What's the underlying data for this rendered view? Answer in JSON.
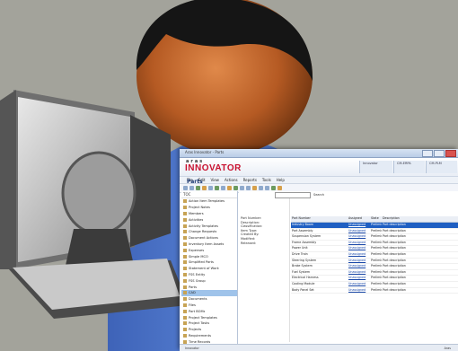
{
  "window": {
    "title": "Aras Innovator - Parts",
    "brand_small": "aras",
    "brand_name": "INNOVATOR",
    "status_1": "Innovator",
    "status_2": "CM-ERPA",
    "status_3": "CM-PLM"
  },
  "menu": [
    "File",
    "Edit",
    "View",
    "Actions",
    "Reports",
    "Tools",
    "Help"
  ],
  "sidebar": {
    "header": "TOC",
    "items": [
      "Action Item Templates",
      "Project Notes",
      "Members",
      "Activities",
      "Activity Templates",
      "Change Requests",
      "Document Actions",
      "Inventory Item Assets",
      "Expenses",
      "Simple MCO",
      "Simplified Parts",
      "Statement of Work",
      "FSS Entity",
      "FSS Group",
      "Parts",
      "CAD",
      "Documents",
      "Files",
      "Part BOMs",
      "Project Templates",
      "Project Tasks",
      "Projects",
      "Requirements",
      "Time Records",
      "Work Orders",
      "Parts"
    ],
    "selected_index": 15
  },
  "main": {
    "section": "Parts",
    "search_label": "Search",
    "detail": [
      "Part Number:",
      "Description:",
      "Classification:",
      "Item Type:",
      "Created By:",
      "Modified:",
      "Released:"
    ],
    "grid": {
      "headers": [
        "Part Number",
        "Assigned",
        "State",
        "Description"
      ],
      "rows": [
        [
          "Industry Boom",
          "Unassigned",
          "Preliminary",
          "Part description"
        ],
        [
          "Part Assembly",
          "Unassigned",
          "Preliminary",
          "Part description"
        ],
        [
          "Suspension System",
          "Unassigned",
          "Preliminary",
          "Part description"
        ],
        [
          "Frame Assembly",
          "Unassigned",
          "Preliminary",
          "Part description"
        ],
        [
          "Power Unit",
          "Unassigned",
          "Preliminary",
          "Part description"
        ],
        [
          "Drive Train",
          "Unassigned",
          "Preliminary",
          "Part description"
        ],
        [
          "Steering System",
          "Unassigned",
          "Preliminary",
          "Part description"
        ],
        [
          "Brake System",
          "Unassigned",
          "Preliminary",
          "Part description"
        ],
        [
          "Fuel System",
          "Unassigned",
          "Preliminary",
          "Part description"
        ],
        [
          "Electrical Harness",
          "Unassigned",
          "Preliminary",
          "Part description"
        ],
        [
          "Cooling Module",
          "Unassigned",
          "Preliminary",
          "Part description"
        ],
        [
          "Body Panel Set",
          "Unassigned",
          "Preliminary",
          "Part description"
        ]
      ],
      "selected_row": 0
    }
  },
  "statusbar": {
    "left": "Innovator",
    "right": "Aras"
  },
  "colors": {
    "background": "#a3a39b",
    "brand_red": "#c8102e",
    "selection": "#1f5fc2"
  }
}
